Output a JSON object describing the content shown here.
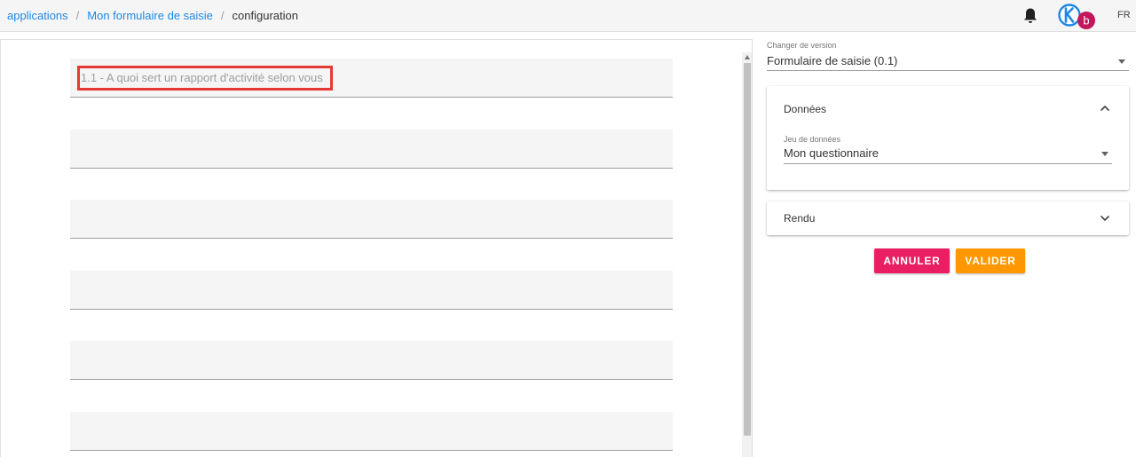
{
  "breadcrumb": {
    "items": [
      "applications",
      "Mon formulaire de saisie"
    ],
    "separator": "/",
    "current": "configuration"
  },
  "header": {
    "avatar_letter": "b",
    "language": "FR"
  },
  "form": {
    "first_field_label": "1.1 - A quoi sert un rapport d'activité selon vous"
  },
  "version": {
    "label": "Changer de version",
    "value": "Formulaire de saisie (0.1)"
  },
  "data_panel": {
    "title": "Données",
    "dataset_label": "Jeu de données",
    "dataset_value": "Mon questionnaire"
  },
  "render_panel": {
    "title": "Rendu"
  },
  "actions": {
    "cancel_label": "ANNULER",
    "validate_label": "VALIDER"
  },
  "colors": {
    "link": "#1e88e5",
    "cancel": "#e91e63",
    "validate": "#ff9800",
    "highlight": "#e53935",
    "avatar_ring": "#1e88e5",
    "avatar_badge": "#c2185b"
  }
}
